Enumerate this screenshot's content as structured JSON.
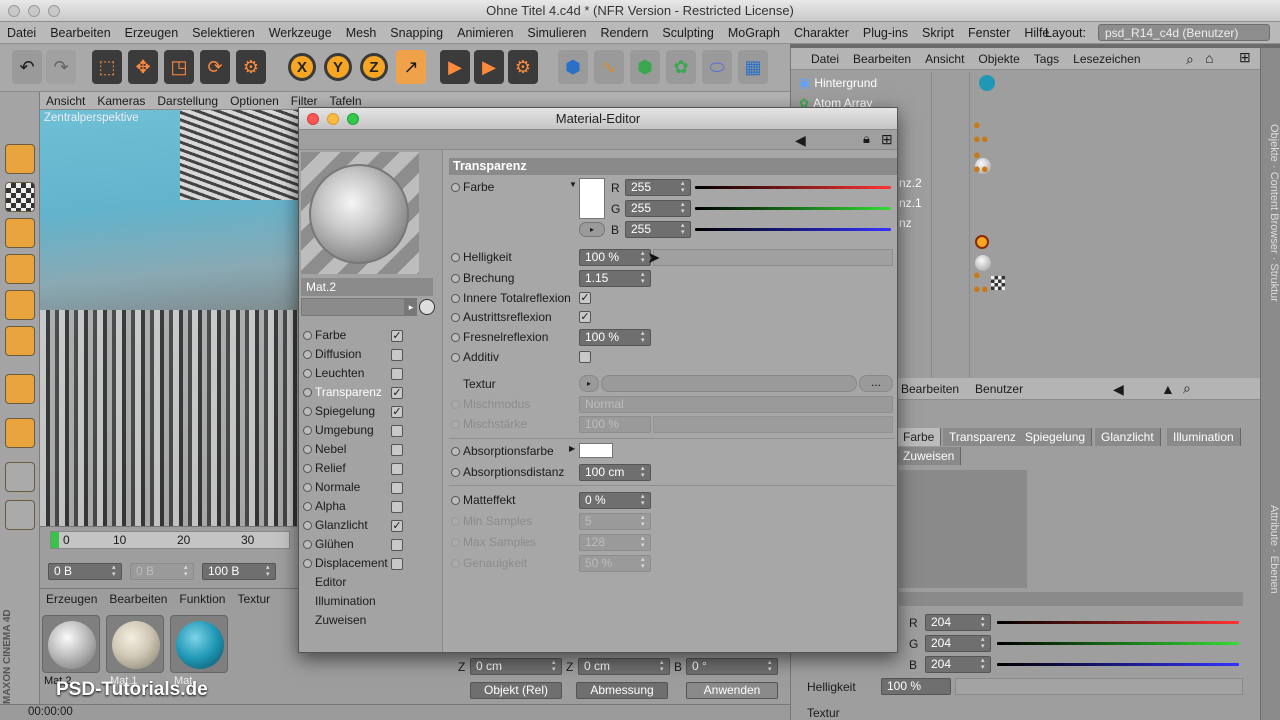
{
  "app": {
    "window_title": "Ohne Titel 4.c4d * (NFR Version - Restricted License)",
    "menu": [
      "Datei",
      "Bearbeiten",
      "Erzeugen",
      "Selektieren",
      "Werkzeuge",
      "Mesh",
      "Snapping",
      "Animieren",
      "Simulieren",
      "Rendern",
      "Sculpting",
      "MoGraph",
      "Charakter",
      "Plug-ins",
      "Skript",
      "Fenster",
      "Hilfe"
    ],
    "layout_label": "Layout:",
    "layout_value": "psd_R14_c4d (Benutzer)"
  },
  "toolbar": {
    "axis_x": "X",
    "axis_y": "Y",
    "axis_z": "Z"
  },
  "viewport": {
    "menu": [
      "Ansicht",
      "Kameras",
      "Darstellung",
      "Optionen",
      "Filter",
      "Tafeln"
    ],
    "label": "Zentralperspektive"
  },
  "timeline": {
    "ticks": [
      "0",
      "10",
      "20",
      "30"
    ],
    "field_start": "0 B",
    "field_mid": "0 B",
    "field_end": "100 B"
  },
  "material_manager": {
    "menu": [
      "Erzeugen",
      "Bearbeiten",
      "Funktion",
      "Textur"
    ],
    "materials": [
      {
        "name": "Mat.2",
        "color": "#c9c9c9"
      },
      {
        "name": "Mat.1",
        "color": "#d7d1c2"
      },
      {
        "name": "Mat",
        "color": "#1f97b5"
      }
    ],
    "brand": "MAXON CINEMA 4D",
    "watermark": "PSD-Tutorials.de"
  },
  "status": {
    "time": "00:00:00"
  },
  "object_manager": {
    "menu": [
      "Datei",
      "Bearbeiten",
      "Ansicht",
      "Objekte",
      "Tags",
      "Lesezeichen"
    ],
    "rows": [
      "Hintergrund",
      "Atom Array",
      "",
      "",
      "",
      "nz.2",
      "nz.1",
      "nz",
      "",
      "",
      ""
    ],
    "side_tabs": [
      "Objekte",
      "Content Browser",
      "Struktur"
    ]
  },
  "attribute_manager": {
    "menu": [
      "Bearbeiten",
      "Benutzer"
    ],
    "tabs": [
      "Farbe",
      "Transparenz",
      "Spiegelung",
      "Glanzlicht",
      "Illumination"
    ],
    "subtab": "Zuweisen",
    "r": "204",
    "g": "204",
    "b": "204",
    "brightness_label": "Helligkeit",
    "brightness": "100 %",
    "texture_label": "Textur",
    "side_tabs": [
      "Attribute",
      "Ebenen"
    ]
  },
  "coords": {
    "z1": "0 cm",
    "z2": "0 cm",
    "b": "0 °",
    "mode1": "Objekt (Rel)",
    "mode2": "Abmessung",
    "apply": "Anwenden",
    "l_z1": "Z",
    "l_z2": "Z",
    "l_b": "B"
  },
  "material_editor": {
    "title": "Material-Editor",
    "material_name": "Mat.2",
    "channels": [
      {
        "label": "Farbe",
        "checked": true
      },
      {
        "label": "Diffusion",
        "checked": false
      },
      {
        "label": "Leuchten",
        "checked": false
      },
      {
        "label": "Transparenz",
        "checked": true
      },
      {
        "label": "Spiegelung",
        "checked": true
      },
      {
        "label": "Umgebung",
        "checked": false
      },
      {
        "label": "Nebel",
        "checked": false
      },
      {
        "label": "Relief",
        "checked": false
      },
      {
        "label": "Normale",
        "checked": false
      },
      {
        "label": "Alpha",
        "checked": false
      },
      {
        "label": "Glanzlicht",
        "checked": true
      },
      {
        "label": "Glühen",
        "checked": false
      },
      {
        "label": "Displacement",
        "checked": false
      }
    ],
    "extra": [
      "Editor",
      "Illumination",
      "Zuweisen"
    ],
    "section": "Transparenz",
    "farbe_label": "Farbe",
    "r_label": "R",
    "g_label": "G",
    "b_label": "B",
    "r": "255",
    "g": "255",
    "b": "255",
    "helligkeit_label": "Helligkeit",
    "helligkeit": "100 %",
    "brechung_label": "Brechung",
    "brechung": "1.15",
    "innere_label": "Innere Totalreflexion",
    "austritt_label": "Austrittsreflexion",
    "fresnel_label": "Fresnelreflexion",
    "fresnel": "100 %",
    "additiv_label": "Additiv",
    "textur_label": "Textur",
    "textur_btn": "...",
    "mischmodus_label": "Mischmodus",
    "mischmodus": "Normal",
    "mischstaerke_label": "Mischstärke",
    "mischstaerke": "100 %",
    "absfarbe_label": "Absorptionsfarbe",
    "absdist_label": "Absorptionsdistanz",
    "absdist": "100 cm",
    "matt_label": "Matteffekt",
    "matt": "0 %",
    "minsamples_label": "Min Samples",
    "minsamples": "5",
    "maxsamples_label": "Max Samples",
    "maxsamples": "128",
    "genauigkeit_label": "Genauigkeit",
    "genauigkeit": "50 %"
  }
}
